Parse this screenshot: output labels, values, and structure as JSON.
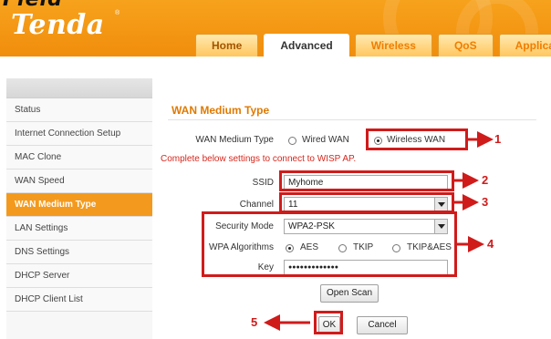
{
  "header": {
    "cut_text": "Field",
    "logo": "Tenda",
    "logo_reg": "®",
    "tabs": [
      {
        "label": "Home"
      },
      {
        "label": "Advanced"
      },
      {
        "label": "Wireless"
      },
      {
        "label": "QoS"
      },
      {
        "label": "Applications"
      }
    ],
    "active_tab": "Advanced"
  },
  "sidebar": {
    "items": [
      {
        "label": "Status"
      },
      {
        "label": "Internet Connection Setup"
      },
      {
        "label": "MAC Clone"
      },
      {
        "label": "WAN Speed"
      },
      {
        "label": "WAN Medium Type"
      },
      {
        "label": "LAN Settings"
      },
      {
        "label": "DNS Settings"
      },
      {
        "label": "DHCP Server"
      },
      {
        "label": "DHCP Client List"
      }
    ],
    "active": "WAN Medium Type"
  },
  "main": {
    "title": "WAN Medium Type",
    "medium_label": "WAN Medium Type",
    "medium_options": [
      {
        "label": "Wired WAN",
        "checked": false
      },
      {
        "label": "Wireless WAN",
        "checked": true
      }
    ],
    "notice": "Complete below settings to connect to WISP AP.",
    "ssid_label": "SSID",
    "ssid_value": "Myhome",
    "channel_label": "Channel",
    "channel_value": "11",
    "security_label": "Security Mode",
    "security_value": "WPA2-PSK",
    "wpa_label": "WPA Algorithms",
    "wpa_options": [
      {
        "label": "AES",
        "checked": true
      },
      {
        "label": "TKIP",
        "checked": false
      },
      {
        "label": "TKIP&AES",
        "checked": false
      }
    ],
    "key_label": "Key",
    "key_value": "●●●●●●●●●●●●●",
    "open_scan_label": "Open Scan",
    "ok_label": "OK",
    "cancel_label": "Cancel"
  },
  "annotations": {
    "numbers": [
      "1",
      "2",
      "3",
      "4",
      "5"
    ],
    "color": "#d01b1b"
  },
  "colors": {
    "header": "#f39a1e",
    "accent": "#e07a00",
    "sidebar_active": "#f39a1e",
    "notice": "#d8261b"
  }
}
